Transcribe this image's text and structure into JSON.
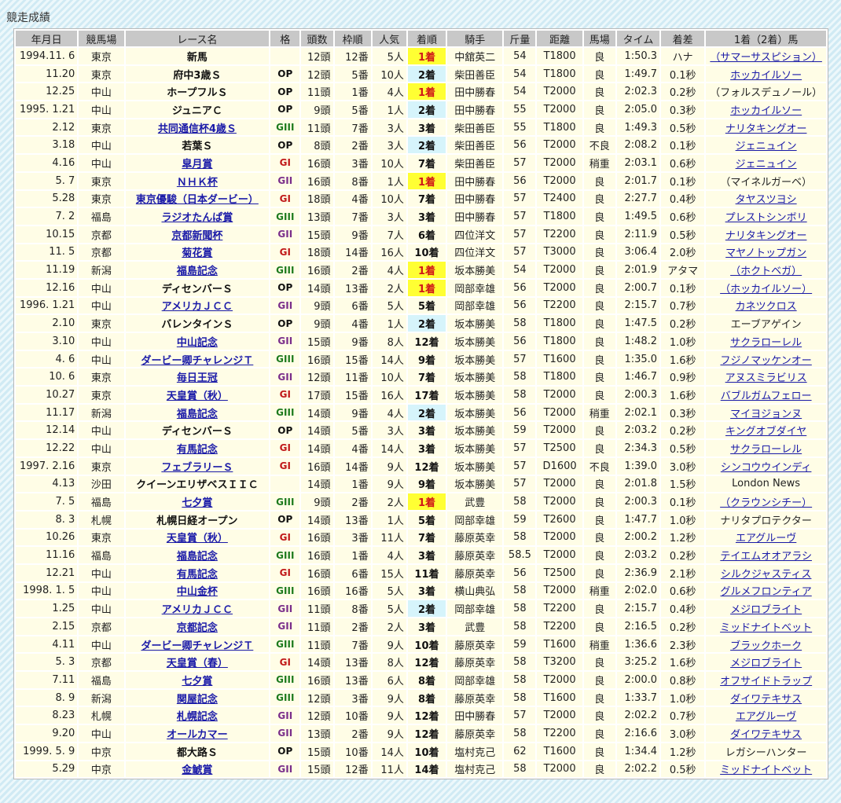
{
  "page": {
    "title": "競走成績"
  },
  "table": {
    "headers": [
      "年月日",
      "競馬場",
      "レース名",
      "格",
      "頭数",
      "枠順",
      "人気",
      "着順",
      "騎手",
      "斤量",
      "距離",
      "馬場",
      "タイム",
      "着差",
      "1着（2着）馬"
    ],
    "rows": [
      {
        "date": "1994.11. 6",
        "course": "東京",
        "race": "新馬",
        "link": false,
        "grade": "",
        "runners": "12頭",
        "post": "12番",
        "pop": "5人",
        "finish": "1着",
        "jockey": "中舘英二",
        "weight": "54",
        "dist": "T1800",
        "track": "良",
        "time": "1:50.3",
        "margin": "ハナ",
        "winner": "（サマーサスピション）",
        "wlink": true
      },
      {
        "date": "11.20",
        "course": "東京",
        "race": "府中3歳Ｓ",
        "link": false,
        "grade": "OP",
        "runners": "12頭",
        "post": "5番",
        "pop": "10人",
        "finish": "2着",
        "jockey": "柴田善臣",
        "weight": "54",
        "dist": "T1800",
        "track": "良",
        "time": "1:49.7",
        "margin": "0.1秒",
        "winner": "ホッカイルソー",
        "wlink": true
      },
      {
        "date": "12.25",
        "course": "中山",
        "race": "ホープフルＳ",
        "link": false,
        "grade": "OP",
        "runners": "11頭",
        "post": "1番",
        "pop": "4人",
        "finish": "1着",
        "jockey": "田中勝春",
        "weight": "54",
        "dist": "T2000",
        "track": "良",
        "time": "2:02.3",
        "margin": "0.2秒",
        "winner": "（フォルスデュノール）",
        "wlink": false
      },
      {
        "date": "1995. 1.21",
        "course": "中山",
        "race": "ジュニアＣ",
        "link": false,
        "grade": "OP",
        "runners": "9頭",
        "post": "5番",
        "pop": "1人",
        "finish": "2着",
        "jockey": "田中勝春",
        "weight": "55",
        "dist": "T2000",
        "track": "良",
        "time": "2:05.0",
        "margin": "0.3秒",
        "winner": "ホッカイルソー",
        "wlink": true
      },
      {
        "date": "2.12",
        "course": "東京",
        "race": "共同通信杯4歳Ｓ",
        "link": true,
        "grade": "GIII",
        "runners": "11頭",
        "post": "7番",
        "pop": "3人",
        "finish": "3着",
        "jockey": "柴田善臣",
        "weight": "55",
        "dist": "T1800",
        "track": "良",
        "time": "1:49.3",
        "margin": "0.5秒",
        "winner": "ナリタキングオー",
        "wlink": true
      },
      {
        "date": "3.18",
        "course": "中山",
        "race": "若葉Ｓ",
        "link": false,
        "grade": "OP",
        "runners": "8頭",
        "post": "2番",
        "pop": "3人",
        "finish": "2着",
        "jockey": "柴田善臣",
        "weight": "56",
        "dist": "T2000",
        "track": "不良",
        "time": "2:08.2",
        "margin": "0.1秒",
        "winner": "ジェニュイン",
        "wlink": true
      },
      {
        "date": "4.16",
        "course": "中山",
        "race": "皐月賞",
        "link": true,
        "grade": "GI",
        "runners": "16頭",
        "post": "3番",
        "pop": "10人",
        "finish": "7着",
        "jockey": "柴田善臣",
        "weight": "57",
        "dist": "T2000",
        "track": "稍重",
        "time": "2:03.1",
        "margin": "0.6秒",
        "winner": "ジェニュイン",
        "wlink": true
      },
      {
        "date": "5. 7",
        "course": "東京",
        "race": "ＮＨＫ杯",
        "link": true,
        "grade": "GII",
        "runners": "16頭",
        "post": "8番",
        "pop": "1人",
        "finish": "1着",
        "jockey": "田中勝春",
        "weight": "56",
        "dist": "T2000",
        "track": "良",
        "time": "2:01.7",
        "margin": "0.1秒",
        "winner": "（マイネルガーベ）",
        "wlink": false
      },
      {
        "date": "5.28",
        "course": "東京",
        "race": "東京優駿（日本ダービー）",
        "link": true,
        "grade": "GI",
        "runners": "18頭",
        "post": "4番",
        "pop": "10人",
        "finish": "7着",
        "jockey": "田中勝春",
        "weight": "57",
        "dist": "T2400",
        "track": "良",
        "time": "2:27.7",
        "margin": "0.4秒",
        "winner": "タヤスツヨシ",
        "wlink": true
      },
      {
        "date": "7. 2",
        "course": "福島",
        "race": "ラジオたんぱ賞",
        "link": true,
        "grade": "GIII",
        "runners": "13頭",
        "post": "7番",
        "pop": "3人",
        "finish": "3着",
        "jockey": "田中勝春",
        "weight": "57",
        "dist": "T1800",
        "track": "良",
        "time": "1:49.5",
        "margin": "0.6秒",
        "winner": "プレストシンボリ",
        "wlink": true
      },
      {
        "date": "10.15",
        "course": "京都",
        "race": "京都新聞杯",
        "link": true,
        "grade": "GII",
        "runners": "15頭",
        "post": "9番",
        "pop": "7人",
        "finish": "6着",
        "jockey": "四位洋文",
        "weight": "57",
        "dist": "T2200",
        "track": "良",
        "time": "2:11.9",
        "margin": "0.5秒",
        "winner": "ナリタキングオー",
        "wlink": true
      },
      {
        "date": "11. 5",
        "course": "京都",
        "race": "菊花賞",
        "link": true,
        "grade": "GI",
        "runners": "18頭",
        "post": "14番",
        "pop": "16人",
        "finish": "10着",
        "jockey": "四位洋文",
        "weight": "57",
        "dist": "T3000",
        "track": "良",
        "time": "3:06.4",
        "margin": "2.0秒",
        "winner": "マヤノトップガン",
        "wlink": true
      },
      {
        "date": "11.19",
        "course": "新潟",
        "race": "福島記念",
        "link": true,
        "grade": "GIII",
        "runners": "16頭",
        "post": "2番",
        "pop": "4人",
        "finish": "1着",
        "jockey": "坂本勝美",
        "weight": "54",
        "dist": "T2000",
        "track": "良",
        "time": "2:01.9",
        "margin": "アタマ",
        "winner": "（ホクトベガ）",
        "wlink": true
      },
      {
        "date": "12.16",
        "course": "中山",
        "race": "ディセンバーＳ",
        "link": false,
        "grade": "OP",
        "runners": "14頭",
        "post": "13番",
        "pop": "2人",
        "finish": "1着",
        "jockey": "岡部幸雄",
        "weight": "56",
        "dist": "T2000",
        "track": "良",
        "time": "2:00.7",
        "margin": "0.1秒",
        "winner": "（ホッカイルソー）",
        "wlink": true
      },
      {
        "date": "1996. 1.21",
        "course": "中山",
        "race": "アメリカＪＣＣ",
        "link": true,
        "grade": "GII",
        "runners": "9頭",
        "post": "6番",
        "pop": "5人",
        "finish": "5着",
        "jockey": "岡部幸雄",
        "weight": "56",
        "dist": "T2200",
        "track": "良",
        "time": "2:15.7",
        "margin": "0.7秒",
        "winner": "カネツクロス",
        "wlink": true
      },
      {
        "date": "2.10",
        "course": "東京",
        "race": "バレンタインＳ",
        "link": false,
        "grade": "OP",
        "runners": "9頭",
        "post": "4番",
        "pop": "1人",
        "finish": "2着",
        "jockey": "坂本勝美",
        "weight": "58",
        "dist": "T1800",
        "track": "良",
        "time": "1:47.5",
        "margin": "0.2秒",
        "winner": "エーブアゲイン",
        "wlink": false
      },
      {
        "date": "3.10",
        "course": "中山",
        "race": "中山記念",
        "link": true,
        "grade": "GII",
        "runners": "15頭",
        "post": "9番",
        "pop": "8人",
        "finish": "12着",
        "jockey": "坂本勝美",
        "weight": "56",
        "dist": "T1800",
        "track": "良",
        "time": "1:48.2",
        "margin": "1.0秒",
        "winner": "サクラローレル",
        "wlink": true
      },
      {
        "date": "4. 6",
        "course": "中山",
        "race": "ダービー卿チャレンジＴ",
        "link": true,
        "grade": "GIII",
        "runners": "16頭",
        "post": "15番",
        "pop": "14人",
        "finish": "9着",
        "jockey": "坂本勝美",
        "weight": "57",
        "dist": "T1600",
        "track": "良",
        "time": "1:35.0",
        "margin": "1.6秒",
        "winner": "フジノマッケンオー",
        "wlink": true
      },
      {
        "date": "10. 6",
        "course": "東京",
        "race": "毎日王冠",
        "link": true,
        "grade": "GII",
        "runners": "12頭",
        "post": "11番",
        "pop": "10人",
        "finish": "7着",
        "jockey": "坂本勝美",
        "weight": "58",
        "dist": "T1800",
        "track": "良",
        "time": "1:46.7",
        "margin": "0.9秒",
        "winner": "アヌスミラビリス",
        "wlink": true
      },
      {
        "date": "10.27",
        "course": "東京",
        "race": "天皇賞（秋）",
        "link": true,
        "grade": "GI",
        "runners": "17頭",
        "post": "15番",
        "pop": "16人",
        "finish": "17着",
        "jockey": "坂本勝美",
        "weight": "58",
        "dist": "T2000",
        "track": "良",
        "time": "2:00.3",
        "margin": "1.6秒",
        "winner": "バブルガムフェロー",
        "wlink": true
      },
      {
        "date": "11.17",
        "course": "新潟",
        "race": "福島記念",
        "link": true,
        "grade": "GIII",
        "runners": "14頭",
        "post": "9番",
        "pop": "4人",
        "finish": "2着",
        "jockey": "坂本勝美",
        "weight": "56",
        "dist": "T2000",
        "track": "稍重",
        "time": "2:02.1",
        "margin": "0.3秒",
        "winner": "マイヨジョンヌ",
        "wlink": true
      },
      {
        "date": "12.14",
        "course": "中山",
        "race": "ディセンバーＳ",
        "link": false,
        "grade": "OP",
        "runners": "14頭",
        "post": "5番",
        "pop": "3人",
        "finish": "3着",
        "jockey": "坂本勝美",
        "weight": "59",
        "dist": "T2000",
        "track": "良",
        "time": "2:03.2",
        "margin": "0.2秒",
        "winner": "キングオブダイヤ",
        "wlink": true
      },
      {
        "date": "12.22",
        "course": "中山",
        "race": "有馬記念",
        "link": true,
        "grade": "GI",
        "runners": "14頭",
        "post": "4番",
        "pop": "14人",
        "finish": "3着",
        "jockey": "坂本勝美",
        "weight": "57",
        "dist": "T2500",
        "track": "良",
        "time": "2:34.3",
        "margin": "0.5秒",
        "winner": "サクラローレル",
        "wlink": true
      },
      {
        "date": "1997. 2.16",
        "course": "東京",
        "race": "フェブラリーＳ",
        "link": true,
        "grade": "GI",
        "runners": "16頭",
        "post": "14番",
        "pop": "9人",
        "finish": "12着",
        "jockey": "坂本勝美",
        "weight": "57",
        "dist": "D1600",
        "track": "不良",
        "time": "1:39.0",
        "margin": "3.0秒",
        "winner": "シンコウウインディ",
        "wlink": true
      },
      {
        "date": "4.13",
        "course": "沙田",
        "race": "クイーンエリザベスＩＩＣ",
        "link": false,
        "grade": "",
        "runners": "14頭",
        "post": "1番",
        "pop": "9人",
        "finish": "9着",
        "jockey": "坂本勝美",
        "weight": "57",
        "dist": "T2000",
        "track": "良",
        "time": "2:01.8",
        "margin": "1.5秒",
        "winner": "London News",
        "wlink": false
      },
      {
        "date": "7. 5",
        "course": "福島",
        "race": "七夕賞",
        "link": true,
        "grade": "GIII",
        "runners": "9頭",
        "post": "2番",
        "pop": "2人",
        "finish": "1着",
        "jockey": "武豊",
        "weight": "58",
        "dist": "T2000",
        "track": "良",
        "time": "2:00.3",
        "margin": "0.1秒",
        "winner": "（クラウンシチー）",
        "wlink": true
      },
      {
        "date": "8. 3",
        "course": "札幌",
        "race": "札幌日経オープン",
        "link": false,
        "grade": "OP",
        "runners": "14頭",
        "post": "13番",
        "pop": "1人",
        "finish": "5着",
        "jockey": "岡部幸雄",
        "weight": "59",
        "dist": "T2600",
        "track": "良",
        "time": "1:47.7",
        "margin": "1.0秒",
        "winner": "ナリタプロテクター",
        "wlink": false
      },
      {
        "date": "10.26",
        "course": "東京",
        "race": "天皇賞（秋）",
        "link": true,
        "grade": "GI",
        "runners": "16頭",
        "post": "3番",
        "pop": "11人",
        "finish": "7着",
        "jockey": "藤原英幸",
        "weight": "58",
        "dist": "T2000",
        "track": "良",
        "time": "2:00.2",
        "margin": "1.2秒",
        "winner": "エアグルーヴ",
        "wlink": true
      },
      {
        "date": "11.16",
        "course": "福島",
        "race": "福島記念",
        "link": true,
        "grade": "GIII",
        "runners": "16頭",
        "post": "1番",
        "pop": "4人",
        "finish": "3着",
        "jockey": "藤原英幸",
        "weight": "58.5",
        "dist": "T2000",
        "track": "良",
        "time": "2:03.2",
        "margin": "0.2秒",
        "winner": "テイエムオオアラシ",
        "wlink": true
      },
      {
        "date": "12.21",
        "course": "中山",
        "race": "有馬記念",
        "link": true,
        "grade": "GI",
        "runners": "16頭",
        "post": "6番",
        "pop": "15人",
        "finish": "11着",
        "jockey": "藤原英幸",
        "weight": "56",
        "dist": "T2500",
        "track": "良",
        "time": "2:36.9",
        "margin": "2.1秒",
        "winner": "シルクジャスティス",
        "wlink": true
      },
      {
        "date": "1998. 1. 5",
        "course": "中山",
        "race": "中山金杯",
        "link": true,
        "grade": "GIII",
        "runners": "16頭",
        "post": "16番",
        "pop": "5人",
        "finish": "3着",
        "jockey": "横山典弘",
        "weight": "58",
        "dist": "T2000",
        "track": "稍重",
        "time": "2:02.0",
        "margin": "0.6秒",
        "winner": "グルメフロンティア",
        "wlink": true
      },
      {
        "date": "1.25",
        "course": "中山",
        "race": "アメリカＪＣＣ",
        "link": true,
        "grade": "GII",
        "runners": "11頭",
        "post": "8番",
        "pop": "5人",
        "finish": "2着",
        "jockey": "岡部幸雄",
        "weight": "58",
        "dist": "T2200",
        "track": "良",
        "time": "2:15.7",
        "margin": "0.4秒",
        "winner": "メジロブライト",
        "wlink": true
      },
      {
        "date": "2.15",
        "course": "京都",
        "race": "京都記念",
        "link": true,
        "grade": "GII",
        "runners": "11頭",
        "post": "2番",
        "pop": "2人",
        "finish": "3着",
        "jockey": "武豊",
        "weight": "58",
        "dist": "T2200",
        "track": "良",
        "time": "2:16.5",
        "margin": "0.2秒",
        "winner": "ミッドナイトベット",
        "wlink": true
      },
      {
        "date": "4.11",
        "course": "中山",
        "race": "ダービー卿チャレンジＴ",
        "link": true,
        "grade": "GIII",
        "runners": "11頭",
        "post": "7番",
        "pop": "9人",
        "finish": "10着",
        "jockey": "藤原英幸",
        "weight": "59",
        "dist": "T1600",
        "track": "稍重",
        "time": "1:36.6",
        "margin": "2.3秒",
        "winner": "ブラックホーク",
        "wlink": true
      },
      {
        "date": "5. 3",
        "course": "京都",
        "race": "天皇賞（春）",
        "link": true,
        "grade": "GI",
        "runners": "14頭",
        "post": "13番",
        "pop": "8人",
        "finish": "12着",
        "jockey": "藤原英幸",
        "weight": "58",
        "dist": "T3200",
        "track": "良",
        "time": "3:25.2",
        "margin": "1.6秒",
        "winner": "メジロブライト",
        "wlink": true
      },
      {
        "date": "7.11",
        "course": "福島",
        "race": "七夕賞",
        "link": true,
        "grade": "GIII",
        "runners": "16頭",
        "post": "13番",
        "pop": "6人",
        "finish": "8着",
        "jockey": "岡部幸雄",
        "weight": "58",
        "dist": "T2000",
        "track": "良",
        "time": "2:00.0",
        "margin": "0.8秒",
        "winner": "オフサイドトラップ",
        "wlink": true
      },
      {
        "date": "8. 9",
        "course": "新潟",
        "race": "関屋記念",
        "link": true,
        "grade": "GIII",
        "runners": "12頭",
        "post": "3番",
        "pop": "9人",
        "finish": "8着",
        "jockey": "藤原英幸",
        "weight": "58",
        "dist": "T1600",
        "track": "良",
        "time": "1:33.7",
        "margin": "1.0秒",
        "winner": "ダイワテキサス",
        "wlink": true
      },
      {
        "date": "8.23",
        "course": "札幌",
        "race": "札幌記念",
        "link": true,
        "grade": "GII",
        "runners": "12頭",
        "post": "10番",
        "pop": "9人",
        "finish": "12着",
        "jockey": "田中勝春",
        "weight": "57",
        "dist": "T2000",
        "track": "良",
        "time": "2:02.2",
        "margin": "0.7秒",
        "winner": "エアグルーヴ",
        "wlink": true
      },
      {
        "date": "9.20",
        "course": "中山",
        "race": "オールカマー",
        "link": true,
        "grade": "GII",
        "runners": "13頭",
        "post": "2番",
        "pop": "9人",
        "finish": "12着",
        "jockey": "藤原英幸",
        "weight": "58",
        "dist": "T2200",
        "track": "良",
        "time": "2:16.6",
        "margin": "3.0秒",
        "winner": "ダイワテキサス",
        "wlink": true
      },
      {
        "date": "1999. 5. 9",
        "course": "中京",
        "race": "都大路Ｓ",
        "link": false,
        "grade": "OP",
        "runners": "15頭",
        "post": "10番",
        "pop": "14人",
        "finish": "10着",
        "jockey": "塩村克己",
        "weight": "62",
        "dist": "T1600",
        "track": "良",
        "time": "1:34.4",
        "margin": "1.2秒",
        "winner": "レガシーハンター",
        "wlink": false
      },
      {
        "date": "5.29",
        "course": "中京",
        "race": "金鯱賞",
        "link": true,
        "grade": "GII",
        "runners": "15頭",
        "post": "12番",
        "pop": "11人",
        "finish": "14着",
        "jockey": "塩村克己",
        "weight": "58",
        "dist": "T2000",
        "track": "良",
        "time": "2:02.2",
        "margin": "0.5秒",
        "winner": "ミッドナイトベット",
        "wlink": true
      }
    ]
  }
}
